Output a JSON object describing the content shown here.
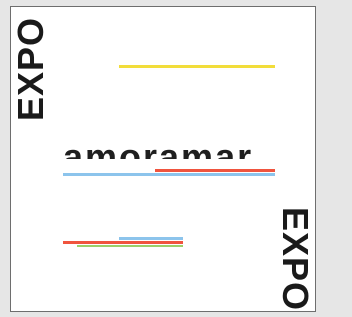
{
  "poster": {
    "side_word_top": "EXPO",
    "side_word_bottom": "EXPO",
    "wordmark": "amoramar",
    "tiny_heading": "",
    "tiny_lines": []
  },
  "colors": {
    "yellow": "#f2dd3a",
    "blue": "#8cc4ec",
    "red": "#f0543e",
    "green": "#9bd06a",
    "ink": "#1f1f1f"
  }
}
